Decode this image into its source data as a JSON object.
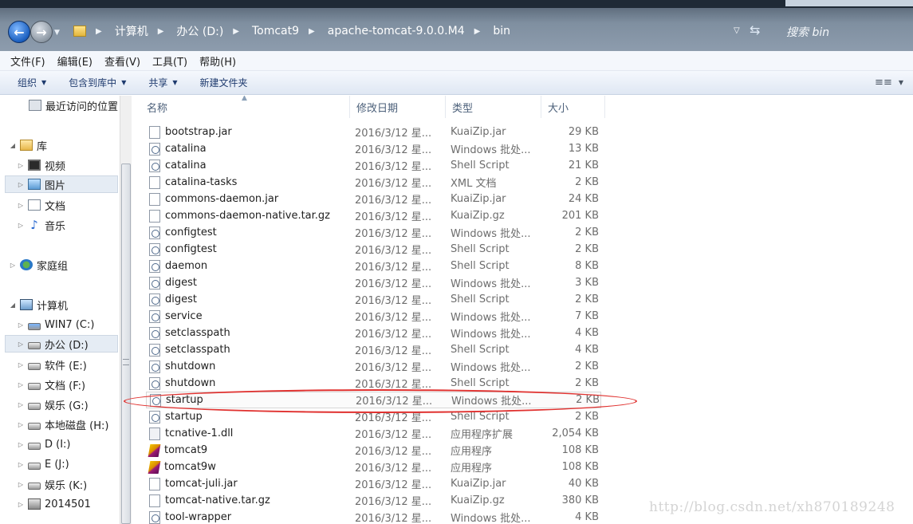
{
  "address_bar": {
    "crumbs": [
      "计算机",
      "办公 (D:)",
      "Tomcat9",
      "apache-tomcat-9.0.0.M4",
      "bin"
    ],
    "search_placeholder": "搜索 bin"
  },
  "menu": [
    "文件(F)",
    "编辑(E)",
    "查看(V)",
    "工具(T)",
    "帮助(H)"
  ],
  "toolbar": {
    "organize": "组织",
    "include_in_library": "包含到库中",
    "share": "共享",
    "new_folder": "新建文件夹"
  },
  "sidebar": {
    "recent": "最近访问的位置",
    "library": "库",
    "library_items": [
      "视频",
      "图片",
      "文档",
      "音乐"
    ],
    "homegroup": "家庭组",
    "computer": "计算机",
    "drives": [
      "WIN7 (C:)",
      "办公 (D:)",
      "软件 (E:)",
      "文档 (F:)",
      "娱乐 (G:)",
      "本地磁盘 (H:)",
      "D (I:)",
      "E (J:)",
      "娱乐 (K:)",
      "2014501"
    ]
  },
  "columns": {
    "name": "名称",
    "date": "修改日期",
    "type": "类型",
    "size": "大小"
  },
  "files": [
    {
      "name": "bootstrap.jar",
      "date": "2016/3/12 星...",
      "type": "KuaiZip.jar",
      "size": "29 KB",
      "icon": "blank-file"
    },
    {
      "name": "catalina",
      "date": "2016/3/12 星...",
      "type": "Windows 批处...",
      "size": "13 KB",
      "icon": "script-file"
    },
    {
      "name": "catalina",
      "date": "2016/3/12 星...",
      "type": "Shell Script",
      "size": "21 KB",
      "icon": "script-file"
    },
    {
      "name": "catalina-tasks",
      "date": "2016/3/12 星...",
      "type": "XML 文档",
      "size": "2 KB",
      "icon": "xml-file"
    },
    {
      "name": "commons-daemon.jar",
      "date": "2016/3/12 星...",
      "type": "KuaiZip.jar",
      "size": "24 KB",
      "icon": "blank-file"
    },
    {
      "name": "commons-daemon-native.tar.gz",
      "date": "2016/3/12 星...",
      "type": "KuaiZip.gz",
      "size": "201 KB",
      "icon": "blank-file"
    },
    {
      "name": "configtest",
      "date": "2016/3/12 星...",
      "type": "Windows 批处...",
      "size": "2 KB",
      "icon": "script-file"
    },
    {
      "name": "configtest",
      "date": "2016/3/12 星...",
      "type": "Shell Script",
      "size": "2 KB",
      "icon": "script-file"
    },
    {
      "name": "daemon",
      "date": "2016/3/12 星...",
      "type": "Shell Script",
      "size": "8 KB",
      "icon": "script-file"
    },
    {
      "name": "digest",
      "date": "2016/3/12 星...",
      "type": "Windows 批处...",
      "size": "3 KB",
      "icon": "script-file"
    },
    {
      "name": "digest",
      "date": "2016/3/12 星...",
      "type": "Shell Script",
      "size": "2 KB",
      "icon": "script-file"
    },
    {
      "name": "service",
      "date": "2016/3/12 星...",
      "type": "Windows 批处...",
      "size": "7 KB",
      "icon": "script-file"
    },
    {
      "name": "setclasspath",
      "date": "2016/3/12 星...",
      "type": "Windows 批处...",
      "size": "4 KB",
      "icon": "script-file"
    },
    {
      "name": "setclasspath",
      "date": "2016/3/12 星...",
      "type": "Shell Script",
      "size": "4 KB",
      "icon": "script-file"
    },
    {
      "name": "shutdown",
      "date": "2016/3/12 星...",
      "type": "Windows 批处...",
      "size": "2 KB",
      "icon": "script-file"
    },
    {
      "name": "shutdown",
      "date": "2016/3/12 星...",
      "type": "Shell Script",
      "size": "2 KB",
      "icon": "script-file"
    },
    {
      "name": "startup",
      "date": "2016/3/12 星...",
      "type": "Windows 批处...",
      "size": "2 KB",
      "icon": "script-file",
      "selected": true
    },
    {
      "name": "startup",
      "date": "2016/3/12 星...",
      "type": "Shell Script",
      "size": "2 KB",
      "icon": "script-file"
    },
    {
      "name": "tcnative-1.dll",
      "date": "2016/3/12 星...",
      "type": "应用程序扩展",
      "size": "2,054 KB",
      "icon": "dll-file"
    },
    {
      "name": "tomcat9",
      "date": "2016/3/12 星...",
      "type": "应用程序",
      "size": "108 KB",
      "icon": "tomcat-exe"
    },
    {
      "name": "tomcat9w",
      "date": "2016/3/12 星...",
      "type": "应用程序",
      "size": "108 KB",
      "icon": "tomcat-exe"
    },
    {
      "name": "tomcat-juli.jar",
      "date": "2016/3/12 星...",
      "type": "KuaiZip.jar",
      "size": "40 KB",
      "icon": "blank-file"
    },
    {
      "name": "tomcat-native.tar.gz",
      "date": "2016/3/12 星...",
      "type": "KuaiZip.gz",
      "size": "380 KB",
      "icon": "blank-file"
    },
    {
      "name": "tool-wrapper",
      "date": "2016/3/12 星...",
      "type": "Windows 批处...",
      "size": "4 KB",
      "icon": "script-file"
    }
  ],
  "watermark": "http://blog.csdn.net/xh870189248",
  "colors": {
    "annotation_ellipse": "#e0312f",
    "selected_row": "#fbfbfb"
  }
}
